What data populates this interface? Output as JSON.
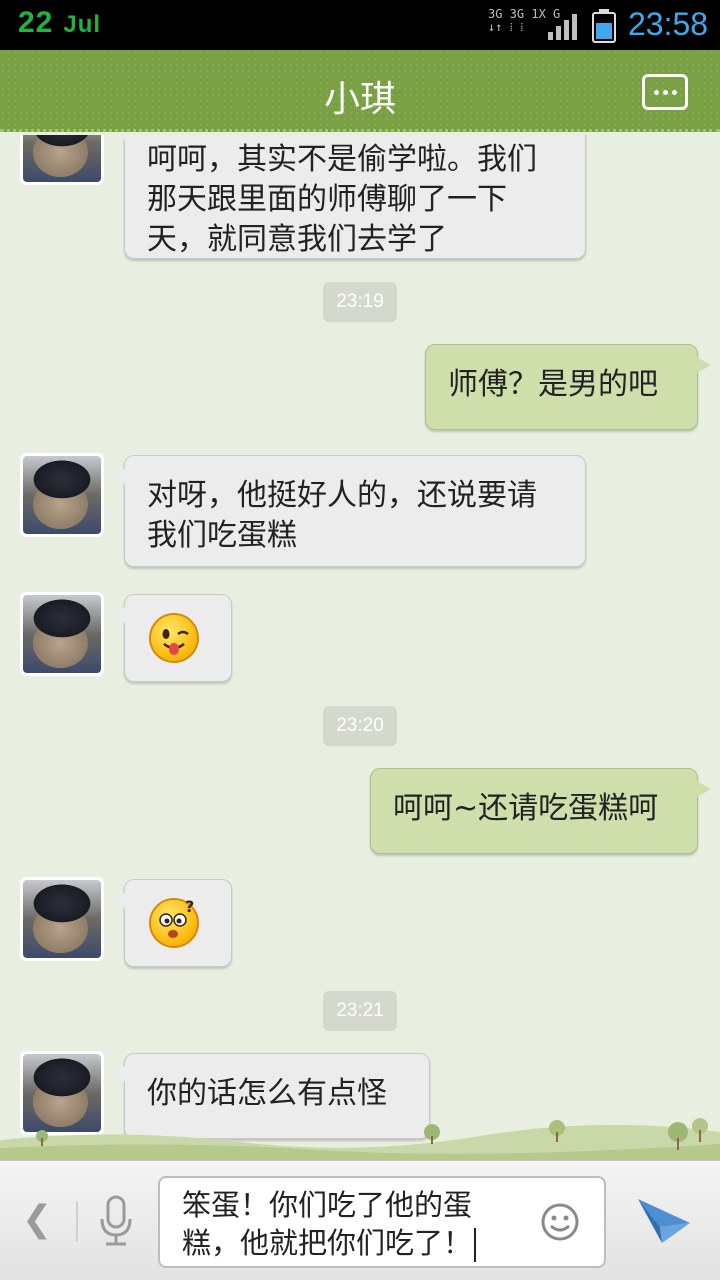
{
  "status_bar": {
    "date_day": "22",
    "date_month": "Jul",
    "network": "3G 3G 1X G",
    "time": "23:58"
  },
  "header": {
    "title": "小琪",
    "more_icon": "more-dots-icon"
  },
  "messages": [
    {
      "side": "in",
      "type": "text",
      "text": "呵呵，其实不是偷学啦。我们那天跟里面的师傅聊了一下天，就同意我们去学了"
    },
    {
      "type": "time",
      "text": "23:19"
    },
    {
      "side": "out",
      "type": "text",
      "text": "师傅？是男的吧"
    },
    {
      "side": "in",
      "type": "text",
      "text": "对呀，他挺好人的，还说要请我们吃蛋糕"
    },
    {
      "side": "in",
      "type": "emoji",
      "emoji": "wink-tongue-emoji"
    },
    {
      "type": "time",
      "text": "23:20"
    },
    {
      "side": "out",
      "type": "text",
      "text": "呵呵~还请吃蛋糕呵"
    },
    {
      "side": "in",
      "type": "emoji",
      "emoji": "confused-emoji"
    },
    {
      "type": "time",
      "text": "23:21"
    },
    {
      "side": "in",
      "type": "text",
      "text": "你的话怎么有点怪"
    }
  ],
  "input_bar": {
    "value": "笨蛋！你们吃了他的蛋糕，他就把你们吃了！",
    "back_icon": "chevron-left-icon",
    "mic_icon": "microphone-icon",
    "emoji_icon": "smiley-icon",
    "send_icon": "send-icon"
  },
  "colors": {
    "header_green": "#79a043",
    "outgoing_bubble": "#cfdfac",
    "incoming_bubble": "#ececec",
    "chat_bg": "#e8efe0",
    "time_blue": "#3fa9ec"
  }
}
